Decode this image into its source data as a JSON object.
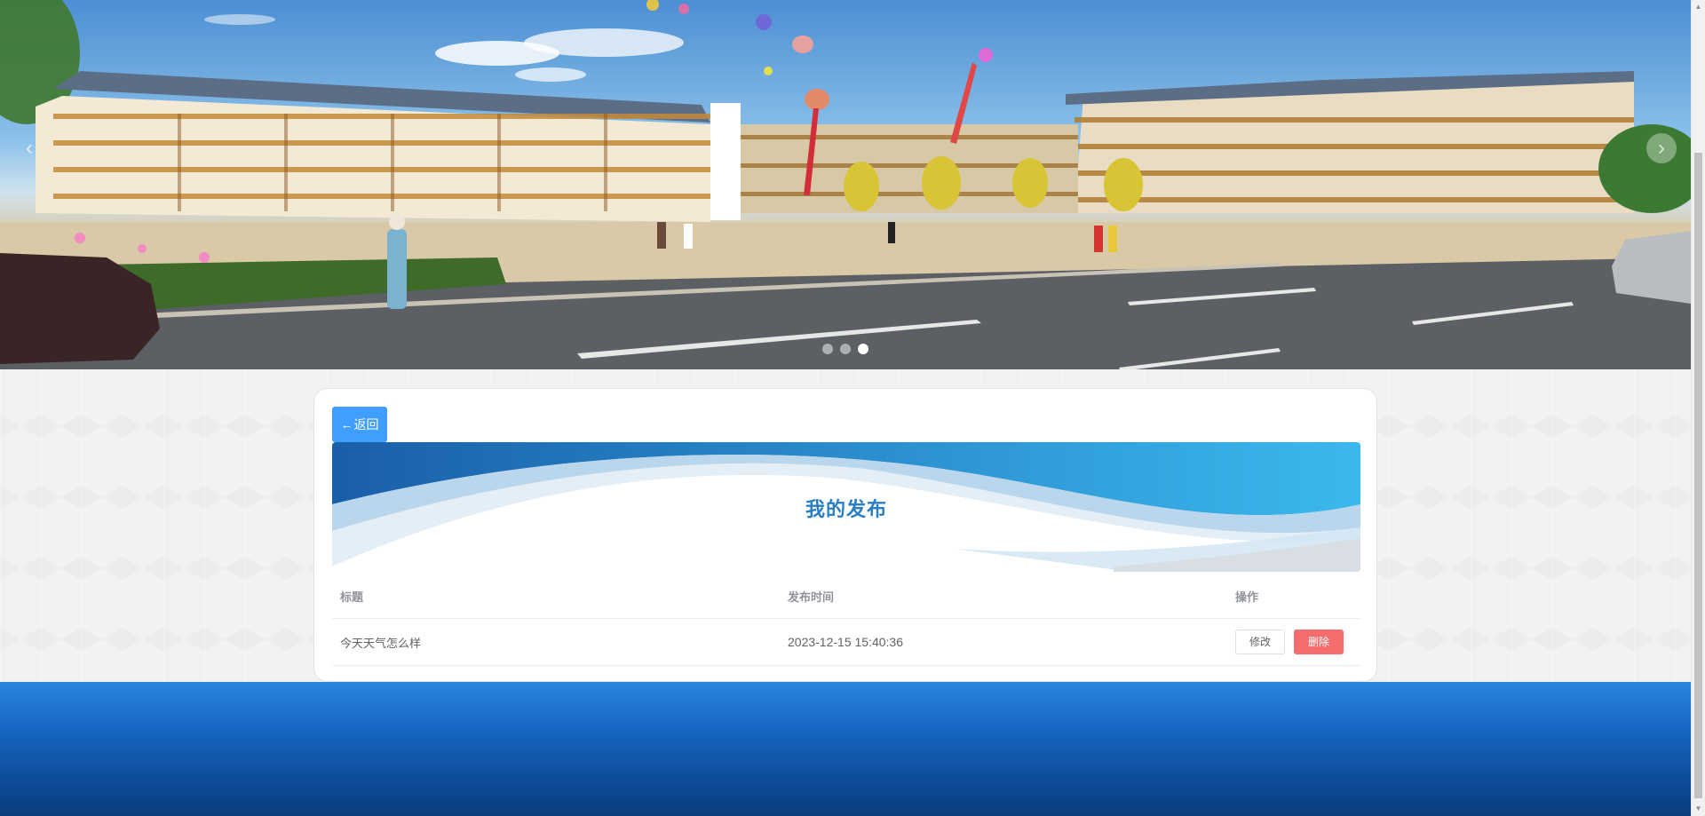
{
  "banner": {
    "prev_arrow": "‹",
    "next_arrow": "›",
    "slide_count": 3,
    "active_slide": 3
  },
  "back_button": {
    "arrow": "←",
    "label": "返回"
  },
  "page_title": "我的发布",
  "table": {
    "headers": [
      "标题",
      "发布时间",
      "操作"
    ],
    "rows": [
      {
        "title": "今天天气怎么样",
        "publish_time": "2023-12-15 15:40:36",
        "edit_label": "修改",
        "delete_label": "删除"
      }
    ]
  },
  "colors": {
    "primary": "#409eff",
    "danger": "#f56c6c",
    "title_blue": "#2a7fc4",
    "footer_blue": "#1766c2"
  },
  "icons": {
    "back": "arrow-left-icon",
    "prev": "chevron-left-icon",
    "next": "chevron-right-icon"
  }
}
